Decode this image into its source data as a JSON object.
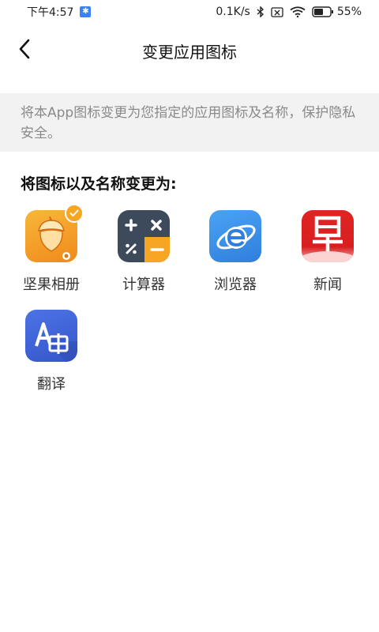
{
  "status_bar": {
    "time": "下午4:57",
    "network_speed": "0.1K/s",
    "battery_percent": "55"
  },
  "header": {
    "title": "变更应用图标"
  },
  "banner": {
    "text": "将本App图标变更为您指定的应用图标及名称，保护隐私安全。"
  },
  "section": {
    "title": "将图标以及名称变更为:"
  },
  "apps": [
    {
      "label": "坚果相册",
      "icon": "acorn-album-icon",
      "selected": true
    },
    {
      "label": "计算器",
      "icon": "calculator-icon",
      "selected": false
    },
    {
      "label": "浏览器",
      "icon": "browser-icon",
      "selected": false
    },
    {
      "label": "新闻",
      "icon": "news-icon",
      "selected": false
    },
    {
      "label": "翻译",
      "icon": "translate-icon",
      "selected": false
    }
  ],
  "colors": {
    "accent_orange": "#f6a623",
    "calculator_bg": "#3d4a5c",
    "browser_bg": "#3b8fe6",
    "news_bg": "#d81e1e",
    "translate_bg": "#3f63d6"
  }
}
